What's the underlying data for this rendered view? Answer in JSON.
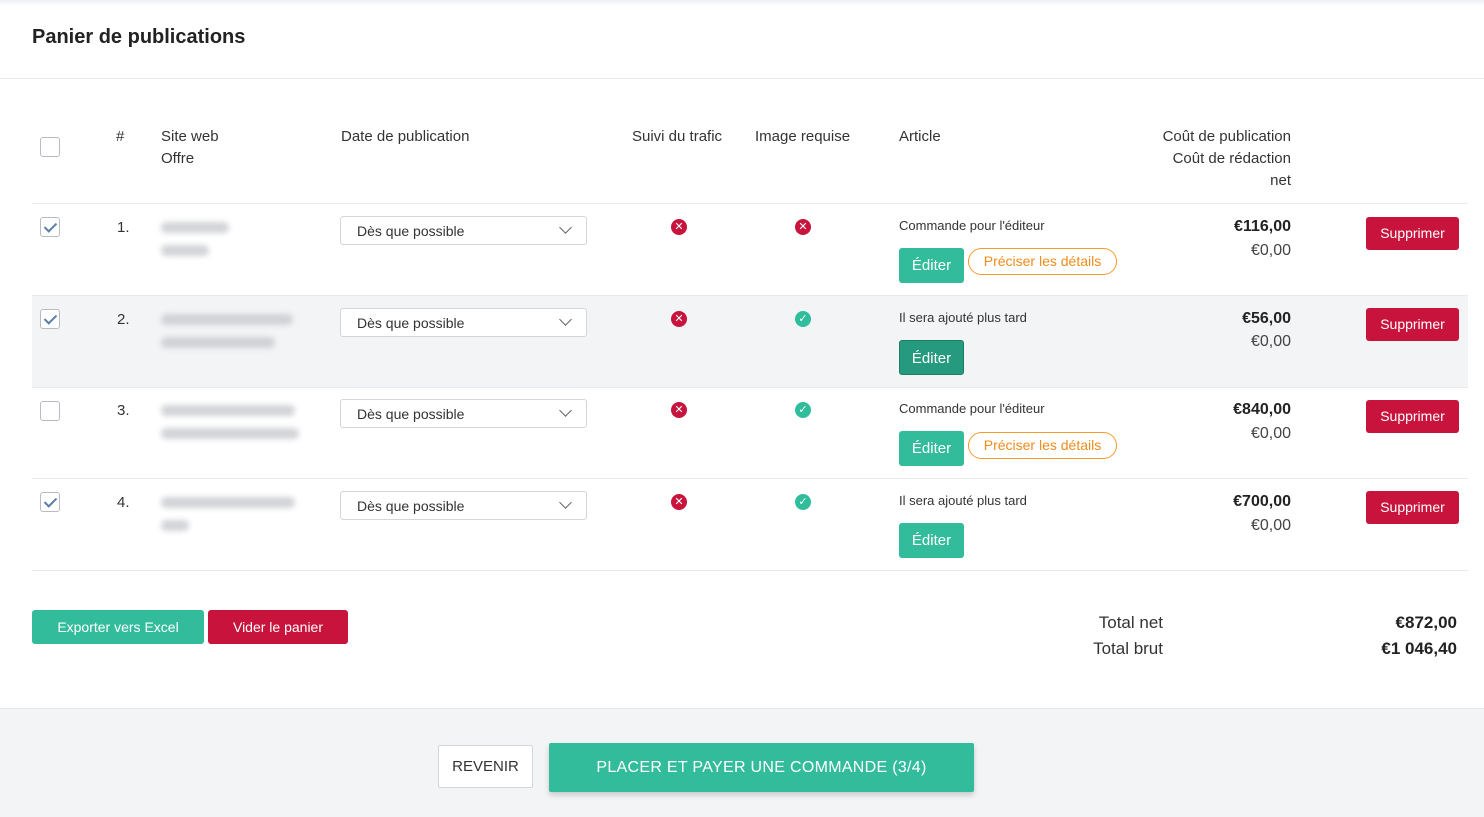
{
  "page": {
    "title": "Panier de publications"
  },
  "table": {
    "headers": {
      "number": "#",
      "site": "Site web",
      "offer": "Offre",
      "date": "Date de publication",
      "traffic": "Suivi du trafic",
      "image": "Image requise",
      "article": "Article",
      "pub_cost": "Coût de publication",
      "writing_cost": "Coût de rédaction",
      "net": "net"
    },
    "rows": [
      {
        "checked": true,
        "num": "1.",
        "date": "Dès que possible",
        "traffic": "no",
        "image": "no",
        "article_text": "Commande pour l'éditeur",
        "edit_label": "Éditer",
        "details_label": "Préciser les détails",
        "pub_cost": "€116,00",
        "writing_cost": "€0,00",
        "delete_label": "Supprimer"
      },
      {
        "checked": true,
        "num": "2.",
        "date": "Dès que possible",
        "traffic": "no",
        "image": "yes",
        "article_text": "Il sera ajouté plus tard",
        "edit_label": "Éditer",
        "pub_cost": "€56,00",
        "writing_cost": "€0,00",
        "delete_label": "Supprimer"
      },
      {
        "checked": false,
        "num": "3.",
        "date": "Dès que possible",
        "traffic": "no",
        "image": "yes",
        "article_text": "Commande pour l'éditeur",
        "edit_label": "Éditer",
        "details_label": "Préciser les détails",
        "pub_cost": "€840,00",
        "writing_cost": "€0,00",
        "delete_label": "Supprimer"
      },
      {
        "checked": true,
        "num": "4.",
        "date": "Dès que possible",
        "traffic": "no",
        "image": "yes",
        "article_text": "Il sera ajouté plus tard",
        "edit_label": "Éditer",
        "pub_cost": "€700,00",
        "writing_cost": "€0,00",
        "delete_label": "Supprimer"
      }
    ]
  },
  "actions": {
    "export": "Exporter vers Excel",
    "clear": "Vider le panier"
  },
  "totals": {
    "net_label": "Total net",
    "net_value": "€872,00",
    "gross_label": "Total brut",
    "gross_value": "€1 046,40"
  },
  "footer": {
    "back": "REVENIR",
    "order": "PLACER ET PAYER UNE COMMANDE (3/4)"
  },
  "colors": {
    "accent": "#33bc9c",
    "danger": "#c8143c",
    "warning": "#f59a2c"
  },
  "icons": {
    "status_no": "x-circle-icon",
    "status_yes": "check-circle-icon",
    "dropdown": "chevron-down-icon"
  }
}
